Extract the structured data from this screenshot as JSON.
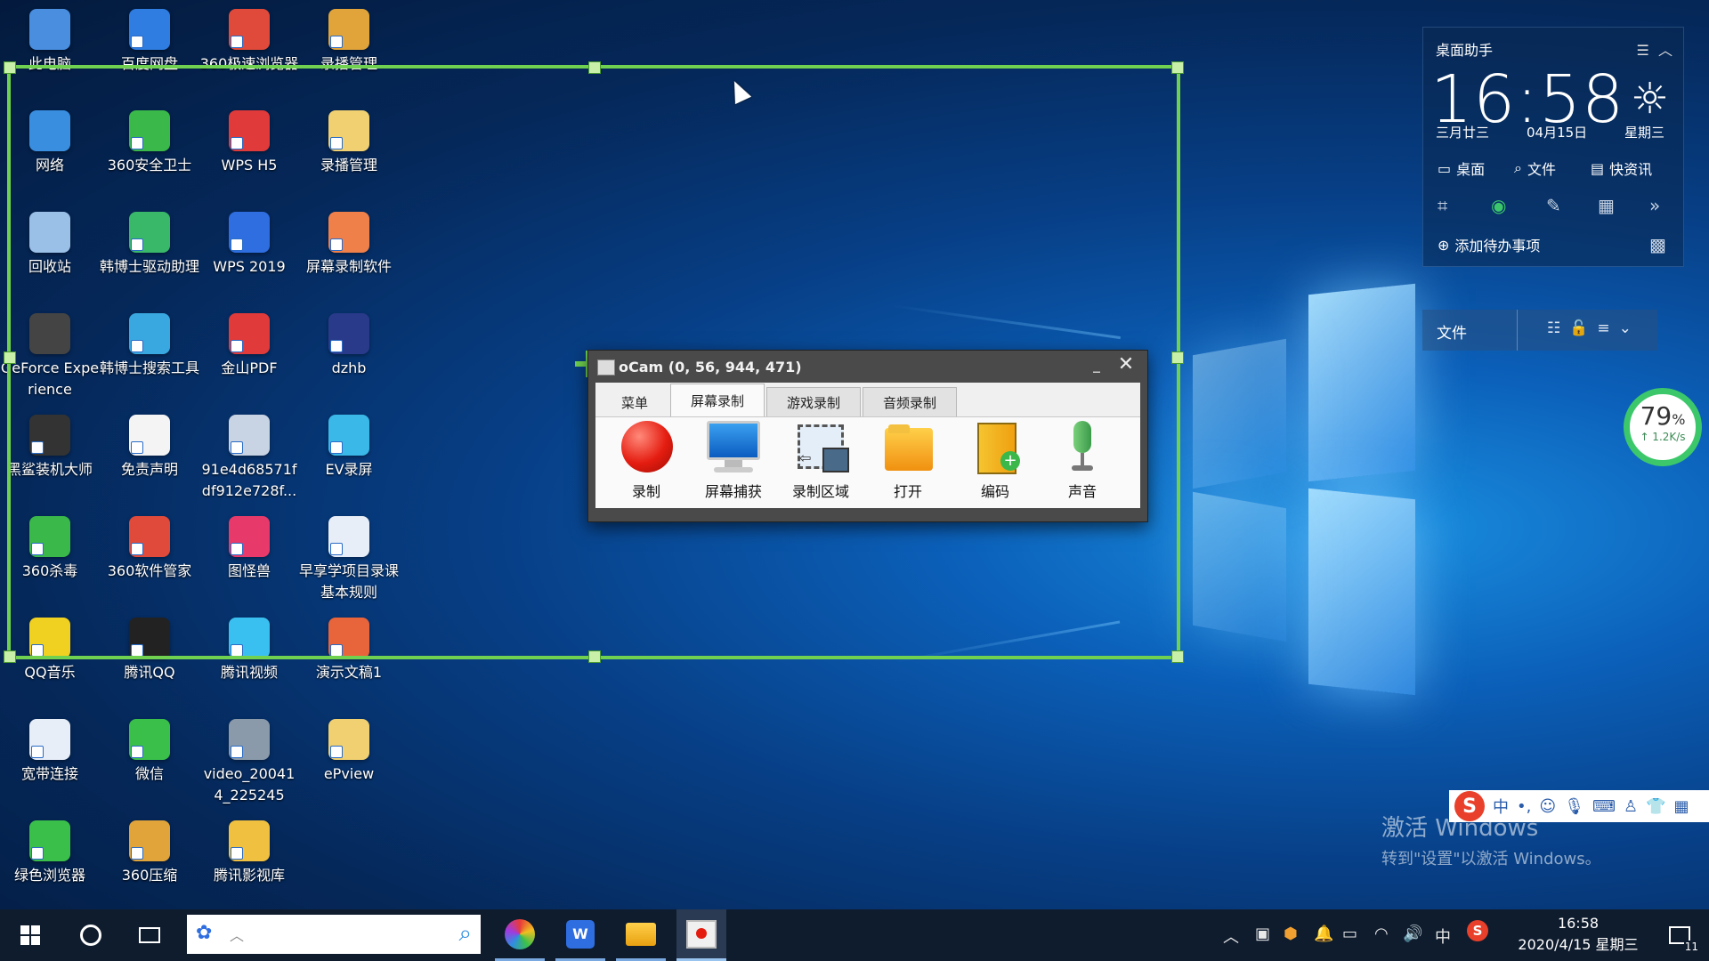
{
  "desktop_icons": [
    {
      "label": "此电脑",
      "color": "#4a8ee0"
    },
    {
      "label": "百度网盘",
      "color": "#2f7de0"
    },
    {
      "label": "360极速浏览器",
      "color": "#e04a3a"
    },
    {
      "label": "录播管理",
      "color": "#e0a43a"
    },
    {
      "label": "网络",
      "color": "#3a8ee0"
    },
    {
      "label": "360安全卫士",
      "color": "#3ab84a"
    },
    {
      "label": "WPS H5",
      "color": "#e03a3a"
    },
    {
      "label": "录播管理",
      "color": "#f0d070"
    },
    {
      "label": "回收站",
      "color": "#9ac0e8"
    },
    {
      "label": "韩博士驱动助理",
      "color": "#3ab86a"
    },
    {
      "label": "WPS 2019",
      "color": "#2f6ee0"
    },
    {
      "label": "屏幕录制软件",
      "color": "#f0804a"
    },
    {
      "label": "GeForce Experience",
      "color": "#444"
    },
    {
      "label": "韩博士搜索工具",
      "color": "#3aa8e0"
    },
    {
      "label": "金山PDF",
      "color": "#e03a3a"
    },
    {
      "label": "dzhb",
      "color": "#2a3a8a"
    },
    {
      "label": "黑鲨装机大师",
      "color": "#333"
    },
    {
      "label": "免责声明",
      "color": "#f4f4f4"
    },
    {
      "label": "91e4d68571fdf912e728f...",
      "color": "#c8d4e4"
    },
    {
      "label": "EV录屏",
      "color": "#3ab8e8"
    },
    {
      "label": "360杀毒",
      "color": "#3ab84a"
    },
    {
      "label": "360软件管家",
      "color": "#e04a3a"
    },
    {
      "label": "图怪兽",
      "color": "#e83a6a"
    },
    {
      "label": "早享学项目录课基本规则",
      "color": "#e8eef8"
    },
    {
      "label": "QQ音乐",
      "color": "#f0d020"
    },
    {
      "label": "腾讯QQ",
      "color": "#222"
    },
    {
      "label": "腾讯视频",
      "color": "#3ac0f0"
    },
    {
      "label": "演示文稿1",
      "color": "#e8643a"
    },
    {
      "label": "宽带连接",
      "color": "#e8eef8"
    },
    {
      "label": "微信",
      "color": "#3ac04a"
    },
    {
      "label": "video_200414_225245",
      "color": "#8a9aaa"
    },
    {
      "label": "ePview",
      "color": "#f0d070"
    },
    {
      "label": "绿色浏览器",
      "color": "#3ac04a"
    },
    {
      "label": "360压缩",
      "color": "#e0a43a"
    },
    {
      "label": "腾讯影视库",
      "color": "#f0c040"
    }
  ],
  "ocam": {
    "title": "oCam (0, 56, 944, 471)",
    "minimize": "_",
    "close": "✕",
    "tabs": [
      "菜单",
      "屏幕录制",
      "游戏录制",
      "音频录制"
    ],
    "active_tab": "屏幕录制",
    "tools": [
      {
        "label": "录制",
        "icon": "record-icon"
      },
      {
        "label": "屏幕捕获",
        "icon": "monitor-icon"
      },
      {
        "label": "录制区域",
        "icon": "region-icon"
      },
      {
        "label": "打开",
        "icon": "folder-icon"
      },
      {
        "label": "编码",
        "icon": "codec-icon"
      },
      {
        "label": "声音",
        "icon": "microphone-icon"
      }
    ]
  },
  "widget": {
    "title": "桌面助手",
    "time": "16:58",
    "lunar": "三月廿三",
    "date": "04月15日",
    "weekday": "星期三",
    "btn_desktop": "桌面",
    "btn_file": "文件",
    "btn_news": "快资讯",
    "todo": "添加待办事项"
  },
  "files_bar": {
    "label": "文件"
  },
  "gauge": {
    "percent": "79",
    "percent_unit": "%",
    "speed": "↑ 1.2K/s"
  },
  "ime": {
    "logo": "S",
    "mode": "中"
  },
  "activation": {
    "line1": "激活 Windows",
    "line2": "转到\"设置\"以激活 Windows。"
  },
  "taskbar": {
    "clock_time": "16:58",
    "clock_date": "2020/4/15 星期三",
    "tray_lang": "中",
    "notif_count": "11"
  },
  "colors": {
    "selection": "#6fd14f",
    "taskbar": "#0f1c2e"
  }
}
